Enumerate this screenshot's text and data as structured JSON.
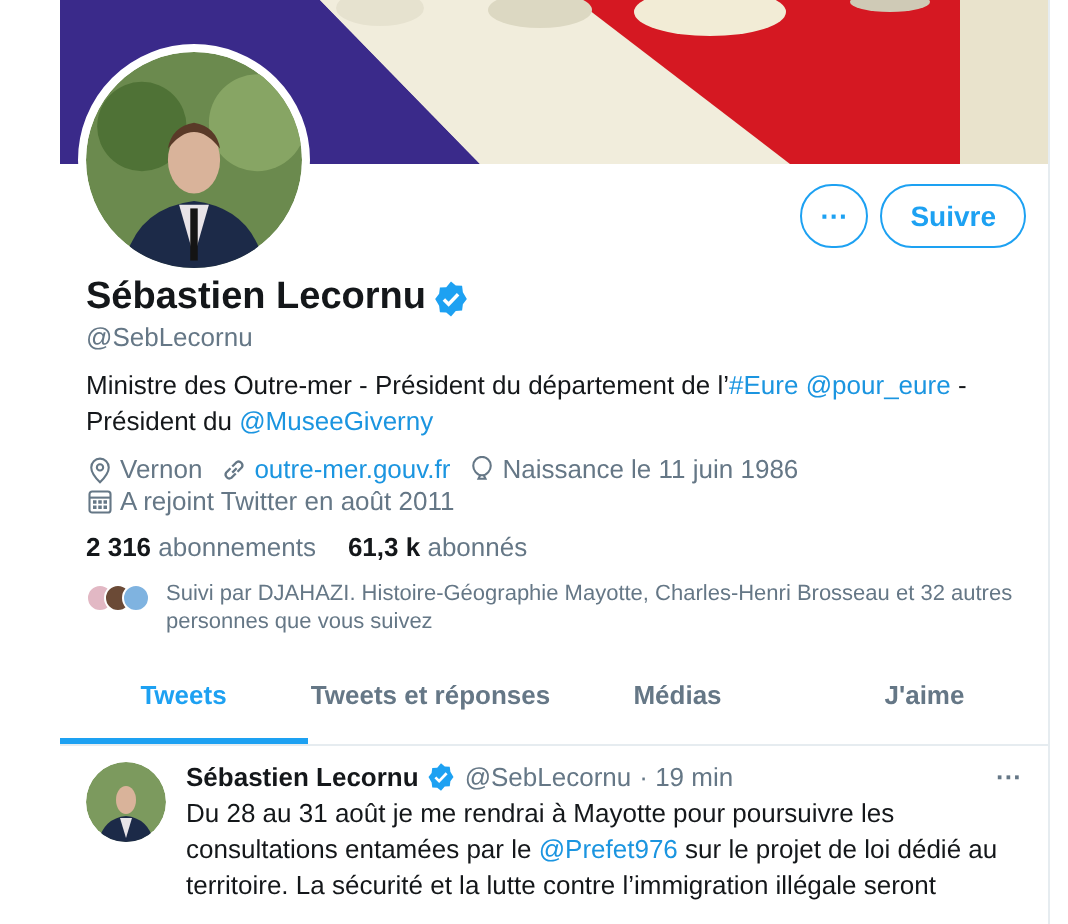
{
  "profile": {
    "name": "Sébastien Lecornu",
    "verified": true,
    "handle": "@SebLecornu",
    "more_button": "···",
    "follow_button": "Suivre",
    "bio": [
      {
        "kind": "text",
        "text": "Ministre des Outre-mer - Président du département de l’"
      },
      {
        "kind": "link",
        "text": "#Eure"
      },
      {
        "kind": "link",
        "text": "@pour_eure"
      },
      {
        "kind": "text",
        "text": " - Président du "
      },
      {
        "kind": "link",
        "text": "@MuseeGiverny"
      }
    ],
    "meta": [
      {
        "kind": "location",
        "text": "Vernon"
      },
      {
        "kind": "url",
        "text": "outre-mer.gouv.fr"
      },
      {
        "kind": "birthday",
        "text": "Naissance le 11 juin 1986"
      },
      {
        "kind": "joined",
        "text": "A rejoint Twitter en août 2011"
      }
    ],
    "stats": [
      {
        "count": "2 316",
        "label": "abonnements"
      },
      {
        "count": "61,3 k",
        "label": "abonnés"
      }
    ],
    "followed_by": "Suivi par DJAHAZI. Histoire-Géographie Mayotte, Charles-Henri Brosseau et 32 autres personnes que vous suivez"
  },
  "tabs": [
    {
      "label": "Tweets",
      "selected": true
    },
    {
      "label": "Tweets et réponses",
      "selected": false
    },
    {
      "label": "Médias",
      "selected": false
    },
    {
      "label": "J'aime",
      "selected": false
    }
  ],
  "tweet": {
    "name": "Sébastien Lecornu",
    "verified": true,
    "handle": "@SebLecornu",
    "time": "· 19 min",
    "more": "···",
    "text": [
      {
        "kind": "text",
        "text": "Du 28 au 31 août je me rendrai à Mayotte pour poursuivre les consultations entamées par le "
      },
      {
        "kind": "link",
        "text": "@Prefet976"
      },
      {
        "kind": "text",
        "text": " sur le projet de loi dédié au territoire. La sécurité et la lutte contre l’immigration illégale seront"
      }
    ]
  }
}
